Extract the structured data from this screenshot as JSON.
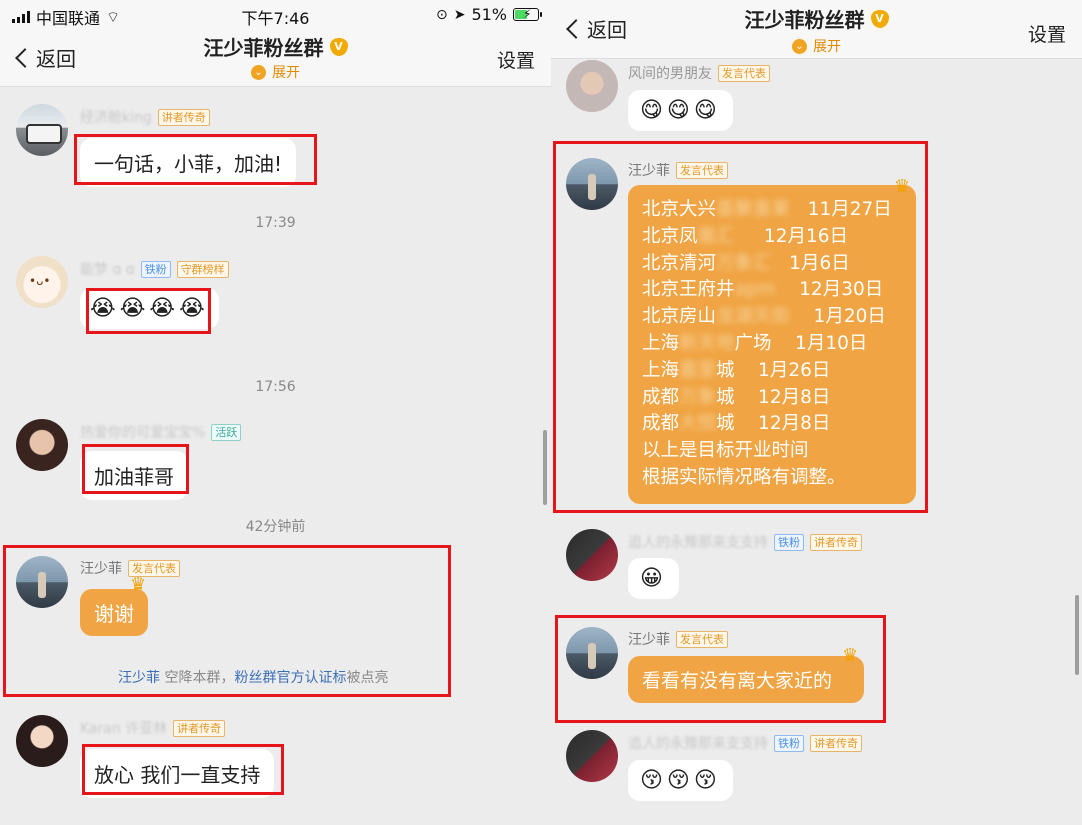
{
  "left": {
    "status": {
      "carrier": "中国联通",
      "time": "下午7:46",
      "battery": "51%"
    },
    "nav": {
      "back": "返回",
      "title": "汪少菲粉丝群",
      "expand": "展开",
      "settings": "设置"
    },
    "messages": {
      "m1": {
        "name": "经济舱king",
        "badges": [
          "讲者传奇"
        ],
        "text": "一句话，小菲，加油!"
      },
      "time1": "17:39",
      "m2": {
        "name": "能梦 ɑ ɑ",
        "badges": [
          "铁粉",
          "守群榜样"
        ],
        "text": "😭😭😭😭"
      },
      "time2": "17:56",
      "m3": {
        "name": "热爱你的可爱宝宝%",
        "badges": [
          "活跃"
        ],
        "text": "加油菲哥"
      },
      "time3": "42分钟前",
      "m4": {
        "name": "汪少菲",
        "badges": [
          "发言代表"
        ],
        "text": "谢谢"
      },
      "system": {
        "name": "汪少菲",
        "mid": " 空降本群，",
        "link": "粉丝群官方认证标",
        "end": "被点亮"
      },
      "m5": {
        "name": "Karan 许亚林",
        "badges": [
          "讲者传奇"
        ],
        "text": "放心 我们一直支持"
      }
    }
  },
  "right": {
    "nav": {
      "back": "返回",
      "title": "汪少菲粉丝群",
      "expand": "展开",
      "settings": "设置"
    },
    "messages": {
      "r1": {
        "name": "风间的男朋友",
        "badges": [
          "发言代表"
        ],
        "text": "😋😋😋"
      },
      "r2": {
        "name": "汪少菲",
        "badges": [
          "发言代表"
        ],
        "lines": [
          {
            "pre": "北京大兴",
            "blur": "荟聚喜莱",
            "post": "   11月27日"
          },
          {
            "pre": "北京凤",
            "blur": "凰汇",
            "post": "     12月16日"
          },
          {
            "pre": "北京清河",
            "blur": "万象汇",
            "post": "   1月6日"
          },
          {
            "pre": "北京王府井",
            "blur": "apm",
            "post": "    12月30日"
          },
          {
            "pre": "北京房山",
            "blur": "龙湖天街",
            "post": "    1月20日"
          },
          {
            "pre": "上海",
            "blur": "新天地",
            "post": "广场    1月10日"
          },
          {
            "pre": "上海",
            "blur": "嘉里",
            "post": "城    1月26日"
          },
          {
            "pre": "成都",
            "blur": "万象",
            "post": "城    12月8日"
          },
          {
            "pre": "成都",
            "blur": "大悦",
            "post": "城    12月8日"
          },
          {
            "pre": "以上是目标开业时间",
            "blur": "",
            "post": ""
          },
          {
            "pre": "根据实际情况略有调整。",
            "blur": "",
            "post": ""
          }
        ]
      },
      "r3": {
        "name": "追人的永豫那来支支持",
        "badges": [
          "铁粉",
          "讲者传奇"
        ],
        "text": "😀"
      },
      "r4": {
        "name": "汪少菲",
        "badges": [
          "发言代表"
        ],
        "text": "看看有没有离大家近的"
      },
      "r5": {
        "name": "追人的永豫那来支支持",
        "badges": [
          "铁粉",
          "讲者传奇"
        ],
        "text": "😚😚😚"
      }
    }
  },
  "colors": {
    "accent": "#f0a443",
    "highlight_box": "#e5151a",
    "link": "#3b6fb6"
  }
}
